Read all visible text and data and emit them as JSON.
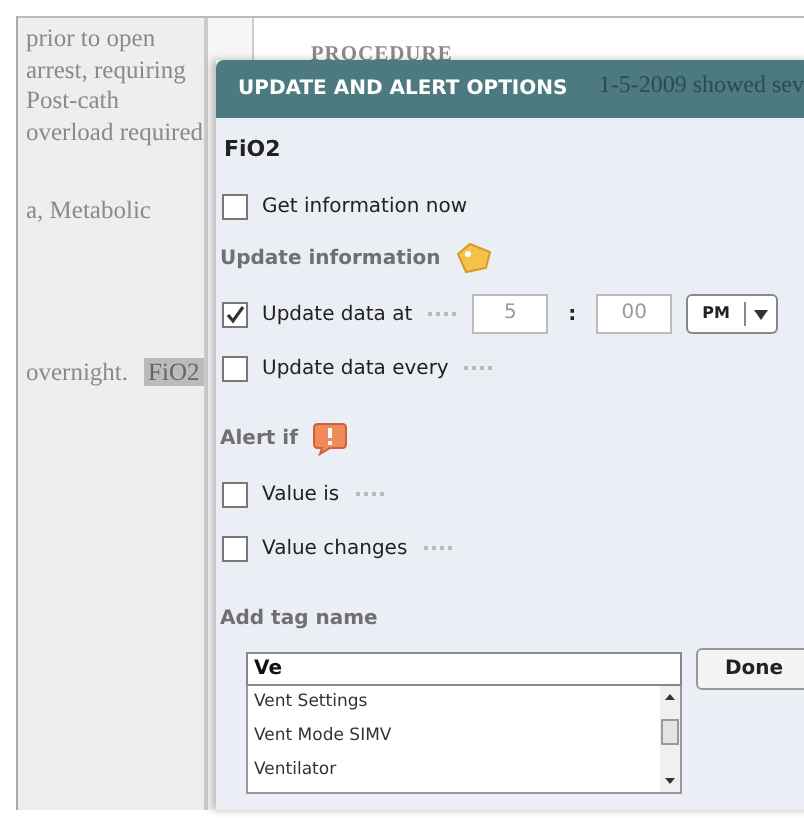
{
  "document": {
    "paragraphs": [
      {
        "lines": [
          "prior to open",
          "arrest, requiring",
          "Post-cath",
          "overload required"
        ]
      },
      {
        "lines": [
          "a, Metabolic"
        ]
      },
      {
        "lines": [
          "overnight."
        ],
        "highlight": "FiO2"
      }
    ],
    "heading": "PROCEDURE",
    "covered_line": "1-5-2009 showed sev"
  },
  "dialog": {
    "title": "UPDATE AND ALERT OPTIONS",
    "subject": "FiO2",
    "get_now": {
      "label": "Get information now",
      "checked": false
    },
    "update": {
      "heading": "Update information",
      "rows": [
        {
          "kind": "time",
          "label": "Update data at",
          "checked": true,
          "hour": "5",
          "minute": "00",
          "separator": ":",
          "period": "PM"
        },
        {
          "kind": "interval",
          "label": "Update data every",
          "checked": false
        }
      ]
    },
    "alert": {
      "heading": "Alert if",
      "rows": [
        {
          "label": "Value is",
          "checked": false
        },
        {
          "label": "Value changes",
          "checked": false
        }
      ]
    },
    "tag": {
      "heading": "Add tag name",
      "value": "Ve",
      "button": "Done",
      "suggestions": [
        {
          "label": "Vent Settings",
          "selected": false
        },
        {
          "label": "Vent Mode SIMV",
          "selected": false
        },
        {
          "label": "Ventilator",
          "selected": false
        }
      ]
    }
  }
}
